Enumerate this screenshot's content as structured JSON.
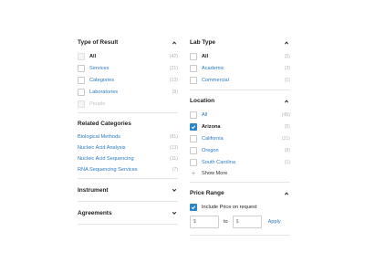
{
  "left": {
    "type_of_result": {
      "title": "Type of Result",
      "options": [
        {
          "label": "All",
          "count": "(42)"
        },
        {
          "label": "Services",
          "count": "(21)"
        },
        {
          "label": "Categories",
          "count": "(13)"
        },
        {
          "label": "Laboratories",
          "count": "(8)"
        },
        {
          "label": "People",
          "count": ""
        }
      ]
    },
    "related_categories": {
      "title": "Related Categories",
      "links": [
        {
          "label": "Biological Methods",
          "count": "(81)"
        },
        {
          "label": "Nucleic Acid Analysis",
          "count": "(13)"
        },
        {
          "label": "Nucleic Acid Sequencing",
          "count": "(11)"
        },
        {
          "label": "RNA Sequencing Services",
          "count": "(7)"
        }
      ]
    },
    "instrument": {
      "title": "Instrument"
    },
    "agreements": {
      "title": "Agreements"
    }
  },
  "right": {
    "lab_type": {
      "title": "Lab Type",
      "options": [
        {
          "label": "All",
          "count": "(5)"
        },
        {
          "label": "Academic",
          "count": "(3)"
        },
        {
          "label": "Commercial",
          "count": "(1)"
        }
      ]
    },
    "location": {
      "title": "Location",
      "options": [
        {
          "label": "All",
          "count": "(45)"
        },
        {
          "label": "Arizona",
          "count": "(5)"
        },
        {
          "label": "California",
          "count": "(21)"
        },
        {
          "label": "Oregon",
          "count": "(8)"
        },
        {
          "label": "South Carolina",
          "count": "(1)"
        }
      ],
      "show_more": "Show More"
    },
    "price_range": {
      "title": "Price Range",
      "include_label": "Include Price on request",
      "min_placeholder": "$",
      "max_placeholder": "$",
      "to_label": "to",
      "apply_label": "Apply"
    }
  },
  "colors": {
    "accent": "#2d86c8",
    "link": "#2a7ac0",
    "muted": "#b4b4b4"
  }
}
